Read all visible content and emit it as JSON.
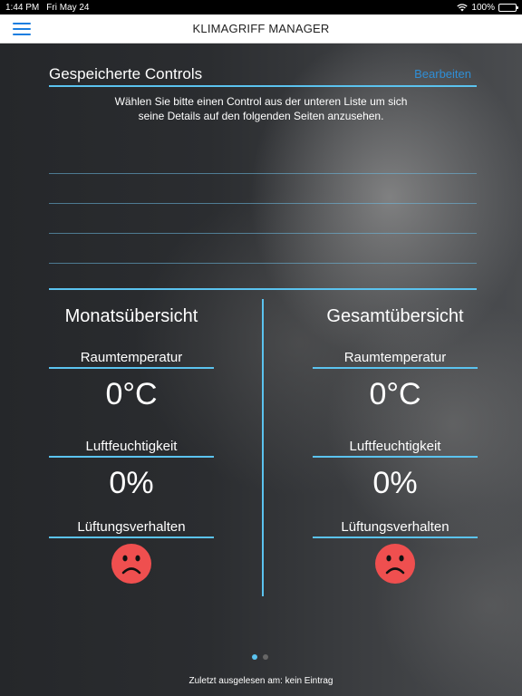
{
  "status_bar": {
    "time": "1:44 PM",
    "date": "Fri May 24",
    "battery": "100%"
  },
  "nav": {
    "title": "KLIMAGRIFF MANAGER",
    "menu_icon": "hamburger-menu-icon"
  },
  "controls": {
    "title": "Gespeicherte Controls",
    "edit_label": "Bearbeiten",
    "instructions": "Wählen Sie bitte einen Control aus der unteren Liste um sich seine Details auf den folgenden Seiten anzusehen."
  },
  "panels": [
    {
      "title": "Monatsübersicht",
      "temperature_label": "Raumtemperatur",
      "temperature_value": "0°C",
      "humidity_label": "Luftfeuchtigkeit",
      "humidity_value": "0%",
      "ventilation_label": "Lüftungsverhalten",
      "ventilation_icon": "sad-face-icon"
    },
    {
      "title": "Gesamtübersicht",
      "temperature_label": "Raumtemperatur",
      "temperature_value": "0°C",
      "humidity_label": "Luftfeuchtigkeit",
      "humidity_value": "0%",
      "ventilation_label": "Lüftungsverhalten",
      "ventilation_icon": "sad-face-icon"
    }
  ],
  "pager": {
    "count": 2,
    "active": 1
  },
  "footer": {
    "last_read": "Zuletzt ausgelesen am: kein Eintrag"
  },
  "colors": {
    "accent": "#5bc3ef",
    "link": "#2f8ed6",
    "menu": "#1a7ee0",
    "sad_face": "#ef4f4f"
  }
}
